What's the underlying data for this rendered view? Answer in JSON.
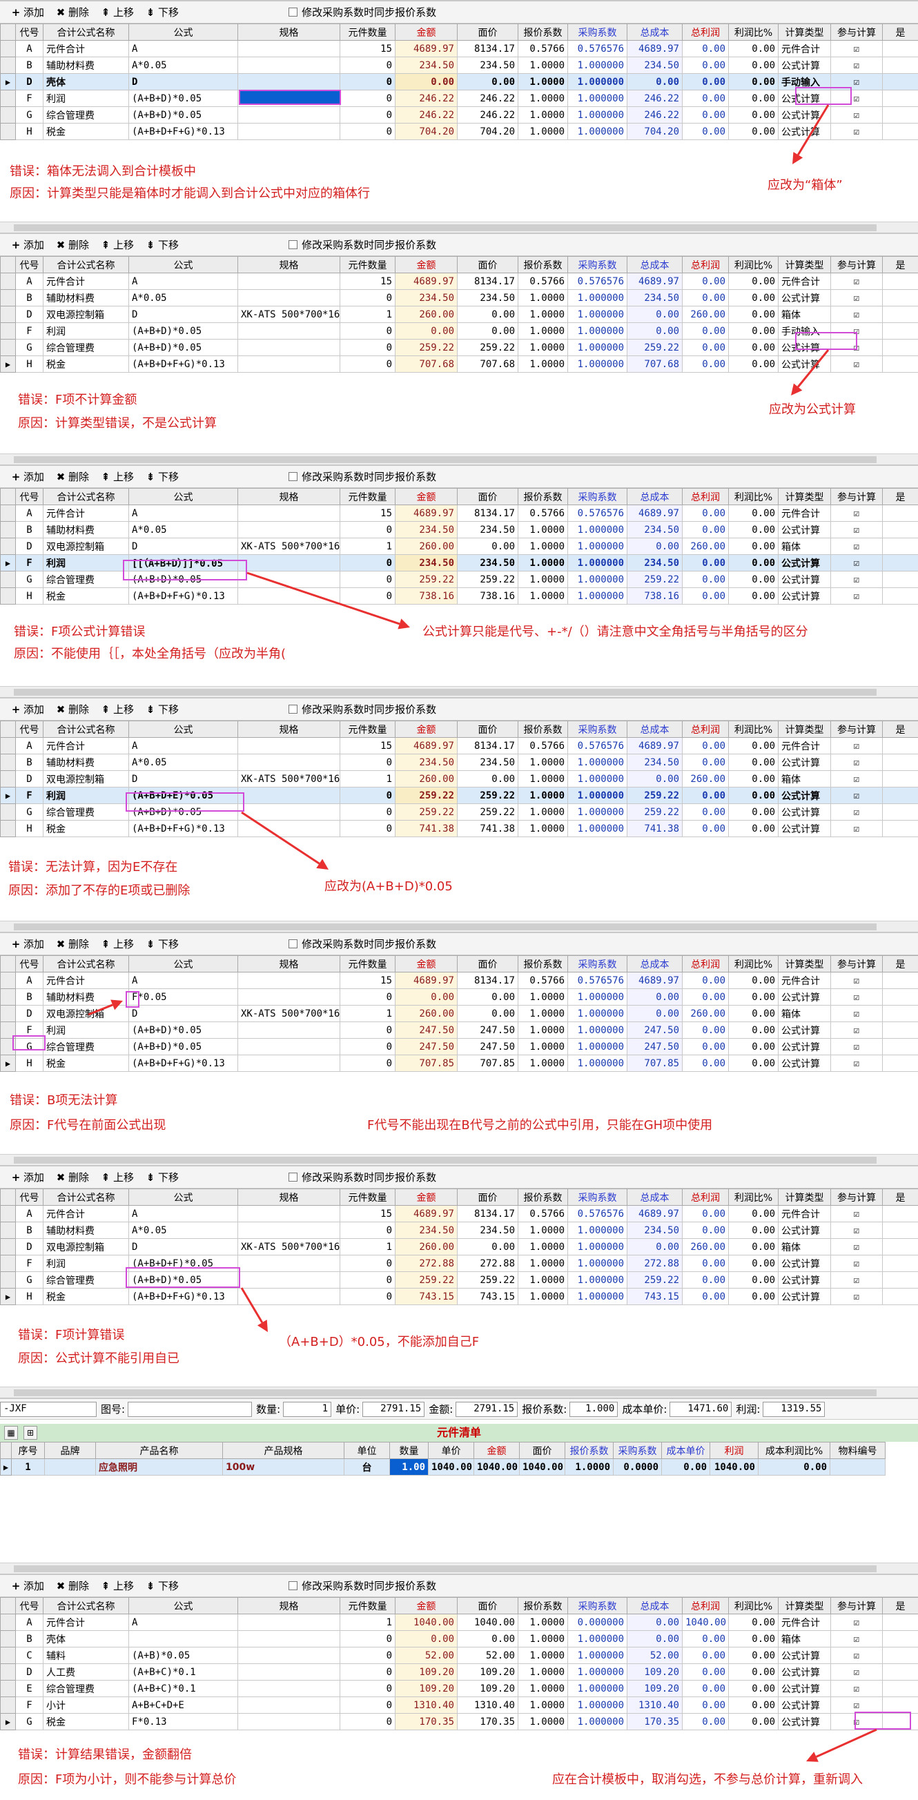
{
  "toolbar": {
    "add": "添加",
    "delete": "删除",
    "up": "上移",
    "down": "下移",
    "sync_checkbox": "修改采购系数时同步报价系数"
  },
  "columns": [
    "代号",
    "合计公式名称",
    "公式",
    "规格",
    "元件数量",
    "金额",
    "面价",
    "报价系数",
    "采购系数",
    "总成本",
    "总利润",
    "利润比%",
    "计算类型",
    "参与计算",
    "是"
  ],
  "sections": [
    {
      "rows": [
        {
          "code": "A",
          "name": "元件合计",
          "formula": "A",
          "spec": "",
          "qty": "15",
          "amount": "4689.97",
          "price": "8134.17",
          "quote": "0.5766",
          "purchase": "0.576576",
          "cost": "4689.97",
          "profit": "0.00",
          "ratio": "0.00",
          "ctype": "元件合计"
        },
        {
          "code": "B",
          "name": "辅助材料费",
          "formula": "A*0.05",
          "spec": "",
          "qty": "0",
          "amount": "234.50",
          "price": "234.50",
          "quote": "1.0000",
          "purchase": "1.000000",
          "cost": "234.50",
          "profit": "0.00",
          "ratio": "0.00",
          "ctype": "公式计算"
        },
        {
          "code": "D",
          "name": "壳体",
          "formula": "D",
          "spec": "",
          "qty": "0",
          "amount": "0.00",
          "price": "0.00",
          "quote": "1.0000",
          "purchase": "1.000000",
          "cost": "0.00",
          "profit": "0.00",
          "ratio": "0.00",
          "ctype": "手动输入"
        },
        {
          "code": "F",
          "name": "利润",
          "formula": "(A+B+D)*0.05",
          "spec": "",
          "qty": "0",
          "amount": "246.22",
          "price": "246.22",
          "quote": "1.0000",
          "purchase": "1.000000",
          "cost": "246.22",
          "profit": "0.00",
          "ratio": "0.00",
          "ctype": "公式计算"
        },
        {
          "code": "G",
          "name": "综合管理费",
          "formula": "(A+B+D)*0.05",
          "spec": "",
          "qty": "0",
          "amount": "246.22",
          "price": "246.22",
          "quote": "1.0000",
          "purchase": "1.000000",
          "cost": "246.22",
          "profit": "0.00",
          "ratio": "0.00",
          "ctype": "公式计算"
        },
        {
          "code": "H",
          "name": "税金",
          "formula": "(A+B+D+F+G)*0.13",
          "spec": "",
          "qty": "0",
          "amount": "704.20",
          "price": "704.20",
          "quote": "1.0000",
          "purchase": "1.000000",
          "cost": "704.20",
          "profit": "0.00",
          "ratio": "0.00",
          "ctype": "公式计算"
        }
      ],
      "notes": [
        "错误：箱体无法调入到合计模板中",
        "原因：计算类型只能是箱体时才能调入到合计公式中对应的箱体行",
        "应改为“箱体”"
      ]
    },
    {
      "rows": [
        {
          "code": "A",
          "name": "元件合计",
          "formula": "A",
          "spec": "",
          "qty": "15",
          "amount": "4689.97",
          "price": "8134.17",
          "quote": "0.5766",
          "purchase": "0.576576",
          "cost": "4689.97",
          "profit": "0.00",
          "ratio": "0.00",
          "ctype": "元件合计"
        },
        {
          "code": "B",
          "name": "辅助材料费",
          "formula": "A*0.05",
          "spec": "",
          "qty": "0",
          "amount": "234.50",
          "price": "234.50",
          "quote": "1.0000",
          "purchase": "1.000000",
          "cost": "234.50",
          "profit": "0.00",
          "ratio": "0.00",
          "ctype": "公式计算"
        },
        {
          "code": "D",
          "name": "双电源控制箱",
          "formula": "D",
          "spec": "XK-ATS 500*700*160",
          "qty": "1",
          "amount": "260.00",
          "price": "0.00",
          "quote": "1.0000",
          "purchase": "1.000000",
          "cost": "0.00",
          "profit": "260.00",
          "ratio": "0.00",
          "ctype": "箱体"
        },
        {
          "code": "F",
          "name": "利润",
          "formula": "(A+B+D)*0.05",
          "spec": "",
          "qty": "0",
          "amount": "0.00",
          "price": "0.00",
          "quote": "1.0000",
          "purchase": "1.000000",
          "cost": "0.00",
          "profit": "0.00",
          "ratio": "0.00",
          "ctype": "手动输入"
        },
        {
          "code": "G",
          "name": "综合管理费",
          "formula": "(A+B+D)*0.05",
          "spec": "",
          "qty": "0",
          "amount": "259.22",
          "price": "259.22",
          "quote": "1.0000",
          "purchase": "1.000000",
          "cost": "259.22",
          "profit": "0.00",
          "ratio": "0.00",
          "ctype": "公式计算"
        },
        {
          "code": "H",
          "name": "税金",
          "formula": "(A+B+D+F+G)*0.13",
          "spec": "",
          "qty": "0",
          "amount": "707.68",
          "price": "707.68",
          "quote": "1.0000",
          "purchase": "1.000000",
          "cost": "707.68",
          "profit": "0.00",
          "ratio": "0.00",
          "ctype": "公式计算"
        }
      ],
      "notes": [
        "错误：F项不计算金额",
        "原因：计算类型错误，不是公式计算",
        "应改为公式计算"
      ]
    },
    {
      "rows": [
        {
          "code": "A",
          "name": "元件合计",
          "formula": "A",
          "spec": "",
          "qty": "15",
          "amount": "4689.97",
          "price": "8134.17",
          "quote": "0.5766",
          "purchase": "0.576576",
          "cost": "4689.97",
          "profit": "0.00",
          "ratio": "0.00",
          "ctype": "元件合计"
        },
        {
          "code": "B",
          "name": "辅助材料费",
          "formula": "A*0.05",
          "spec": "",
          "qty": "0",
          "amount": "234.50",
          "price": "234.50",
          "quote": "1.0000",
          "purchase": "1.000000",
          "cost": "234.50",
          "profit": "0.00",
          "ratio": "0.00",
          "ctype": "公式计算"
        },
        {
          "code": "D",
          "name": "双电源控制箱",
          "formula": "D",
          "spec": "XK-ATS 500*700*160",
          "qty": "1",
          "amount": "260.00",
          "price": "0.00",
          "quote": "1.0000",
          "purchase": "1.000000",
          "cost": "0.00",
          "profit": "260.00",
          "ratio": "0.00",
          "ctype": "箱体"
        },
        {
          "code": "F",
          "name": "利润",
          "formula": "[[（A+B+D）]]*0.05",
          "spec": "",
          "qty": "0",
          "amount": "234.50",
          "price": "234.50",
          "quote": "1.0000",
          "purchase": "1.000000",
          "cost": "234.50",
          "profit": "0.00",
          "ratio": "0.00",
          "ctype": "公式计算"
        },
        {
          "code": "G",
          "name": "综合管理费",
          "formula": "(A+B+D)*0.05",
          "spec": "",
          "qty": "0",
          "amount": "259.22",
          "price": "259.22",
          "quote": "1.0000",
          "purchase": "1.000000",
          "cost": "259.22",
          "profit": "0.00",
          "ratio": "0.00",
          "ctype": "公式计算"
        },
        {
          "code": "H",
          "name": "税金",
          "formula": "(A+B+D+F+G)*0.13",
          "spec": "",
          "qty": "0",
          "amount": "738.16",
          "price": "738.16",
          "quote": "1.0000",
          "purchase": "1.000000",
          "cost": "738.16",
          "profit": "0.00",
          "ratio": "0.00",
          "ctype": "公式计算"
        }
      ],
      "notes": [
        "错误：F项公式计算错误",
        "原因：不能使用｛［，本处全角括号（应改为半角(",
        "公式计算只能是代号、+-*/（）请注意中文全角括号与半角括号的区分"
      ]
    },
    {
      "rows": [
        {
          "code": "A",
          "name": "元件合计",
          "formula": "A",
          "spec": "",
          "qty": "15",
          "amount": "4689.97",
          "price": "8134.17",
          "quote": "0.5766",
          "purchase": "0.576576",
          "cost": "4689.97",
          "profit": "0.00",
          "ratio": "0.00",
          "ctype": "元件合计"
        },
        {
          "code": "B",
          "name": "辅助材料费",
          "formula": "A*0.05",
          "spec": "",
          "qty": "0",
          "amount": "234.50",
          "price": "234.50",
          "quote": "1.0000",
          "purchase": "1.000000",
          "cost": "234.50",
          "profit": "0.00",
          "ratio": "0.00",
          "ctype": "公式计算"
        },
        {
          "code": "D",
          "name": "双电源控制箱",
          "formula": "D",
          "spec": "XK-ATS 500*700*160",
          "qty": "1",
          "amount": "260.00",
          "price": "0.00",
          "quote": "1.0000",
          "purchase": "1.000000",
          "cost": "0.00",
          "profit": "260.00",
          "ratio": "0.00",
          "ctype": "箱体"
        },
        {
          "code": "F",
          "name": "利润",
          "formula": "(A+B+D+E)*0.05",
          "spec": "",
          "qty": "0",
          "amount": "259.22",
          "price": "259.22",
          "quote": "1.0000",
          "purchase": "1.000000",
          "cost": "259.22",
          "profit": "0.00",
          "ratio": "0.00",
          "ctype": "公式计算"
        },
        {
          "code": "G",
          "name": "综合管理费",
          "formula": "(A+B+D)*0.05",
          "spec": "",
          "qty": "0",
          "amount": "259.22",
          "price": "259.22",
          "quote": "1.0000",
          "purchase": "1.000000",
          "cost": "259.22",
          "profit": "0.00",
          "ratio": "0.00",
          "ctype": "公式计算"
        },
        {
          "code": "H",
          "name": "税金",
          "formula": "(A+B+D+F+G)*0.13",
          "spec": "",
          "qty": "0",
          "amount": "741.38",
          "price": "741.38",
          "quote": "1.0000",
          "purchase": "1.000000",
          "cost": "741.38",
          "profit": "0.00",
          "ratio": "0.00",
          "ctype": "公式计算"
        }
      ],
      "notes": [
        "错误：无法计算，因为E不存在",
        "原因：添加了不存的E项或已删除",
        "应改为(A+B+D)*0.05"
      ]
    },
    {
      "rows": [
        {
          "code": "A",
          "name": "元件合计",
          "formula": "A",
          "spec": "",
          "qty": "15",
          "amount": "4689.97",
          "price": "8134.17",
          "quote": "0.5766",
          "purchase": "0.576576",
          "cost": "4689.97",
          "profit": "0.00",
          "ratio": "0.00",
          "ctype": "元件合计"
        },
        {
          "code": "B",
          "name": "辅助材料费",
          "formula": "F*0.05",
          "spec": "",
          "qty": "0",
          "amount": "0.00",
          "price": "0.00",
          "quote": "1.0000",
          "purchase": "1.000000",
          "cost": "0.00",
          "profit": "0.00",
          "ratio": "0.00",
          "ctype": "公式计算"
        },
        {
          "code": "D",
          "name": "双电源控制箱",
          "formula": "D",
          "spec": "XK-ATS 500*700*160",
          "qty": "1",
          "amount": "260.00",
          "price": "0.00",
          "quote": "1.0000",
          "purchase": "1.000000",
          "cost": "0.00",
          "profit": "260.00",
          "ratio": "0.00",
          "ctype": "箱体"
        },
        {
          "code": "F",
          "name": "利润",
          "formula": "(A+B+D)*0.05",
          "spec": "",
          "qty": "0",
          "amount": "247.50",
          "price": "247.50",
          "quote": "1.0000",
          "purchase": "1.000000",
          "cost": "247.50",
          "profit": "0.00",
          "ratio": "0.00",
          "ctype": "公式计算"
        },
        {
          "code": "G",
          "name": "综合管理费",
          "formula": "(A+B+D)*0.05",
          "spec": "",
          "qty": "0",
          "amount": "247.50",
          "price": "247.50",
          "quote": "1.0000",
          "purchase": "1.000000",
          "cost": "247.50",
          "profit": "0.00",
          "ratio": "0.00",
          "ctype": "公式计算"
        },
        {
          "code": "H",
          "name": "税金",
          "formula": "(A+B+D+F+G)*0.13",
          "spec": "",
          "qty": "0",
          "amount": "707.85",
          "price": "707.85",
          "quote": "1.0000",
          "purchase": "1.000000",
          "cost": "707.85",
          "profit": "0.00",
          "ratio": "0.00",
          "ctype": "公式计算"
        }
      ],
      "notes": [
        "错误：B项无法计算",
        "原因：F代号在前面公式出现",
        "F代号不能出现在B代号之前的公式中引用，只能在GH项中使用"
      ]
    },
    {
      "rows": [
        {
          "code": "A",
          "name": "元件合计",
          "formula": "A",
          "spec": "",
          "qty": "15",
          "amount": "4689.97",
          "price": "8134.17",
          "quote": "0.5766",
          "purchase": "0.576576",
          "cost": "4689.97",
          "profit": "0.00",
          "ratio": "0.00",
          "ctype": "元件合计"
        },
        {
          "code": "B",
          "name": "辅助材料费",
          "formula": "A*0.05",
          "spec": "",
          "qty": "0",
          "amount": "234.50",
          "price": "234.50",
          "quote": "1.0000",
          "purchase": "1.000000",
          "cost": "234.50",
          "profit": "0.00",
          "ratio": "0.00",
          "ctype": "公式计算"
        },
        {
          "code": "D",
          "name": "双电源控制箱",
          "formula": "D",
          "spec": "XK-ATS 500*700*160",
          "qty": "1",
          "amount": "260.00",
          "price": "0.00",
          "quote": "1.0000",
          "purchase": "1.000000",
          "cost": "0.00",
          "profit": "260.00",
          "ratio": "0.00",
          "ctype": "箱体"
        },
        {
          "code": "F",
          "name": "利润",
          "formula": "(A+B+D+F)*0.05",
          "spec": "",
          "qty": "0",
          "amount": "272.88",
          "price": "272.88",
          "quote": "1.0000",
          "purchase": "1.000000",
          "cost": "272.88",
          "profit": "0.00",
          "ratio": "0.00",
          "ctype": "公式计算"
        },
        {
          "code": "G",
          "name": "综合管理费",
          "formula": "(A+B+D)*0.05",
          "spec": "",
          "qty": "0",
          "amount": "259.22",
          "price": "259.22",
          "quote": "1.0000",
          "purchase": "1.000000",
          "cost": "259.22",
          "profit": "0.00",
          "ratio": "0.00",
          "ctype": "公式计算"
        },
        {
          "code": "H",
          "name": "税金",
          "formula": "(A+B+D+F+G)*0.13",
          "spec": "",
          "qty": "0",
          "amount": "743.15",
          "price": "743.15",
          "quote": "1.0000",
          "purchase": "1.000000",
          "cost": "743.15",
          "profit": "0.00",
          "ratio": "0.00",
          "ctype": "公式计算"
        }
      ],
      "notes": [
        "错误：F项计算错误",
        "原因：公式计算不能引用自已",
        "（A+B+D）*0.05，不能添加自己F"
      ]
    },
    {
      "rows": [
        {
          "code": "A",
          "name": "元件合计",
          "formula": "A",
          "spec": "",
          "qty": "1",
          "amount": "1040.00",
          "price": "1040.00",
          "quote": "1.0000",
          "purchase": "0.000000",
          "cost": "0.00",
          "profit": "1040.00",
          "ratio": "0.00",
          "ctype": "元件合计"
        },
        {
          "code": "B",
          "name": "壳体",
          "formula": "",
          "spec": "",
          "qty": "0",
          "amount": "0.00",
          "price": "0.00",
          "quote": "1.0000",
          "purchase": "1.000000",
          "cost": "0.00",
          "profit": "0.00",
          "ratio": "0.00",
          "ctype": "箱体"
        },
        {
          "code": "C",
          "name": "辅料",
          "formula": "(A+B)*0.05",
          "spec": "",
          "qty": "0",
          "amount": "52.00",
          "price": "52.00",
          "quote": "1.0000",
          "purchase": "1.000000",
          "cost": "52.00",
          "profit": "0.00",
          "ratio": "0.00",
          "ctype": "公式计算"
        },
        {
          "code": "D",
          "name": "人工费",
          "formula": "(A+B+C)*0.1",
          "spec": "",
          "qty": "0",
          "amount": "109.20",
          "price": "109.20",
          "quote": "1.0000",
          "purchase": "1.000000",
          "cost": "109.20",
          "profit": "0.00",
          "ratio": "0.00",
          "ctype": "公式计算"
        },
        {
          "code": "E",
          "name": "综合管理费",
          "formula": "(A+B+C)*0.1",
          "spec": "",
          "qty": "0",
          "amount": "109.20",
          "price": "109.20",
          "quote": "1.0000",
          "purchase": "1.000000",
          "cost": "109.20",
          "profit": "0.00",
          "ratio": "0.00",
          "ctype": "公式计算"
        },
        {
          "code": "F",
          "name": "小计",
          "formula": "A+B+C+D+E",
          "spec": "",
          "qty": "0",
          "amount": "1310.40",
          "price": "1310.40",
          "quote": "1.0000",
          "purchase": "1.000000",
          "cost": "1310.40",
          "profit": "0.00",
          "ratio": "0.00",
          "ctype": "公式计算"
        },
        {
          "code": "G",
          "name": "税金",
          "formula": "F*0.13",
          "spec": "",
          "qty": "0",
          "amount": "170.35",
          "price": "170.35",
          "quote": "1.0000",
          "purchase": "1.000000",
          "cost": "170.35",
          "profit": "0.00",
          "ratio": "0.00",
          "ctype": "公式计算"
        }
      ],
      "notes": [
        "错误：计算结果错误，金额翻倍",
        "原因：F项为小计，则不能参与计算总价",
        "应在合计模板中，取消勾选，不参与总价计算，重新调入"
      ]
    }
  ],
  "info_bar": {
    "left_value": "-JXF",
    "figure_label": "图号:",
    "figure_value": "",
    "qty_label": "数量:",
    "qty_value": "1",
    "unit_price_label": "单价:",
    "unit_price_value": "2791.15",
    "amount_label": "金额:",
    "amount_value": "2791.15",
    "quote_label": "报价系数:",
    "quote_value": "1.000",
    "cost_label": "成本单价:",
    "cost_value": "1471.60",
    "profit_label": "利润:",
    "profit_value": "1319.55"
  },
  "component_list": {
    "title": "元件清单",
    "columns": [
      "序号",
      "品牌",
      "产品名称",
      "产品规格",
      "单位",
      "数量",
      "单价",
      "金额",
      "面价",
      "报价系数",
      "采购系数",
      "成本单价",
      "利润",
      "成本利润比%",
      "物料编号"
    ],
    "row": {
      "index": "1",
      "brand": "",
      "name": "应急照明",
      "spec": "100w",
      "unit": "台",
      "qty": "1.00",
      "unit_price": "1040.00",
      "amount": "1040.00",
      "price": "1040.00",
      "quote": "1.0000",
      "purchase": "0.0000",
      "cost": "0.00",
      "profit": "1040.00",
      "ratio": "0.00",
      "material": ""
    }
  },
  "colors": {
    "error_text": "#d42020",
    "highlight": "#d24bd8",
    "arrow": "#e83030",
    "selection": "#0a5fd0"
  }
}
